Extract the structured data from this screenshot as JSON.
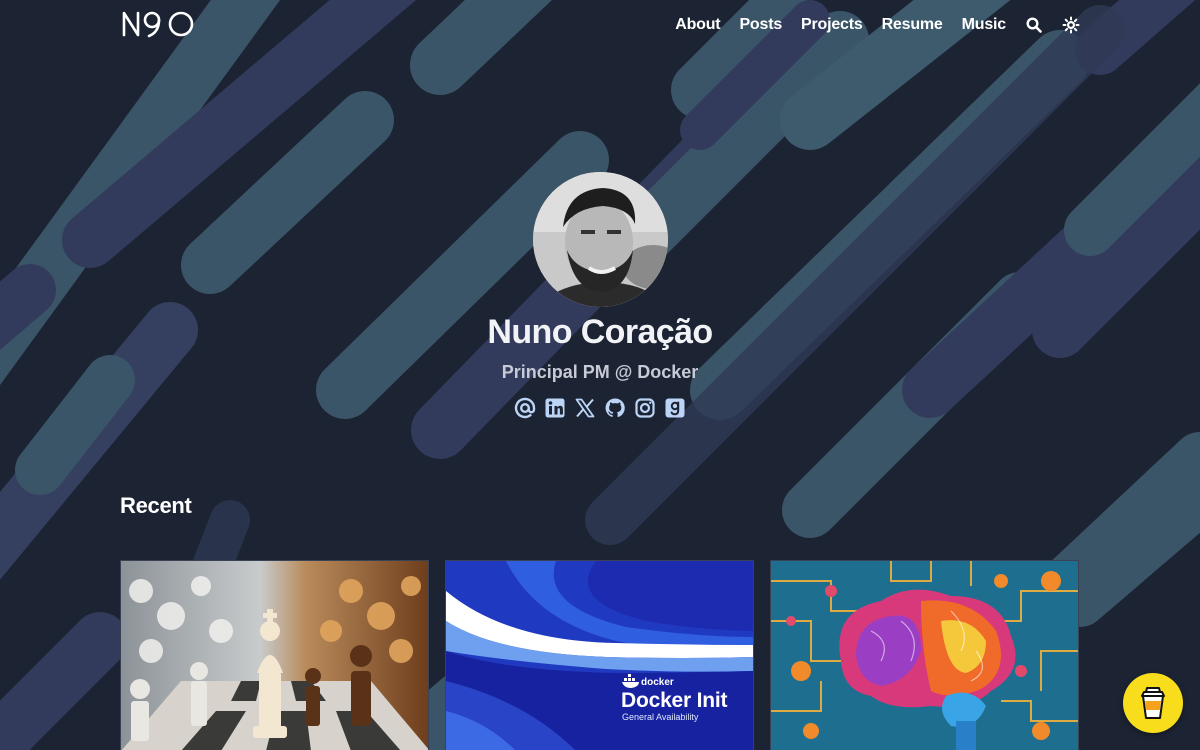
{
  "header": {
    "logo_text": "N9O",
    "nav": [
      {
        "label": "About"
      },
      {
        "label": "Posts"
      },
      {
        "label": "Projects"
      },
      {
        "label": "Resume"
      },
      {
        "label": "Music"
      }
    ],
    "icons": [
      "search-icon",
      "theme-toggle-icon"
    ]
  },
  "profile": {
    "name": "Nuno Coração",
    "role": "Principal PM @ Docker",
    "social_icons": [
      "email-icon",
      "linkedin-icon",
      "x-icon",
      "github-icon",
      "instagram-icon",
      "goodreads-icon"
    ]
  },
  "recent": {
    "title": "Recent",
    "cards": [
      {
        "image": "chess-pieces-illustration"
      },
      {
        "image": "docker-init-banner",
        "brand": "docker",
        "headline": "Docker Init",
        "subline": "General Availability"
      },
      {
        "image": "colorful-brain-illustration"
      }
    ]
  },
  "colors": {
    "background": "#1c2333",
    "stripe_teal": "#3e5b6e",
    "stripe_blue": "#323b5c",
    "accent_yellow": "#f7dd1c",
    "icon_blue": "#bcd4f6"
  },
  "floating": {
    "icon": "coffee-cup-icon"
  }
}
